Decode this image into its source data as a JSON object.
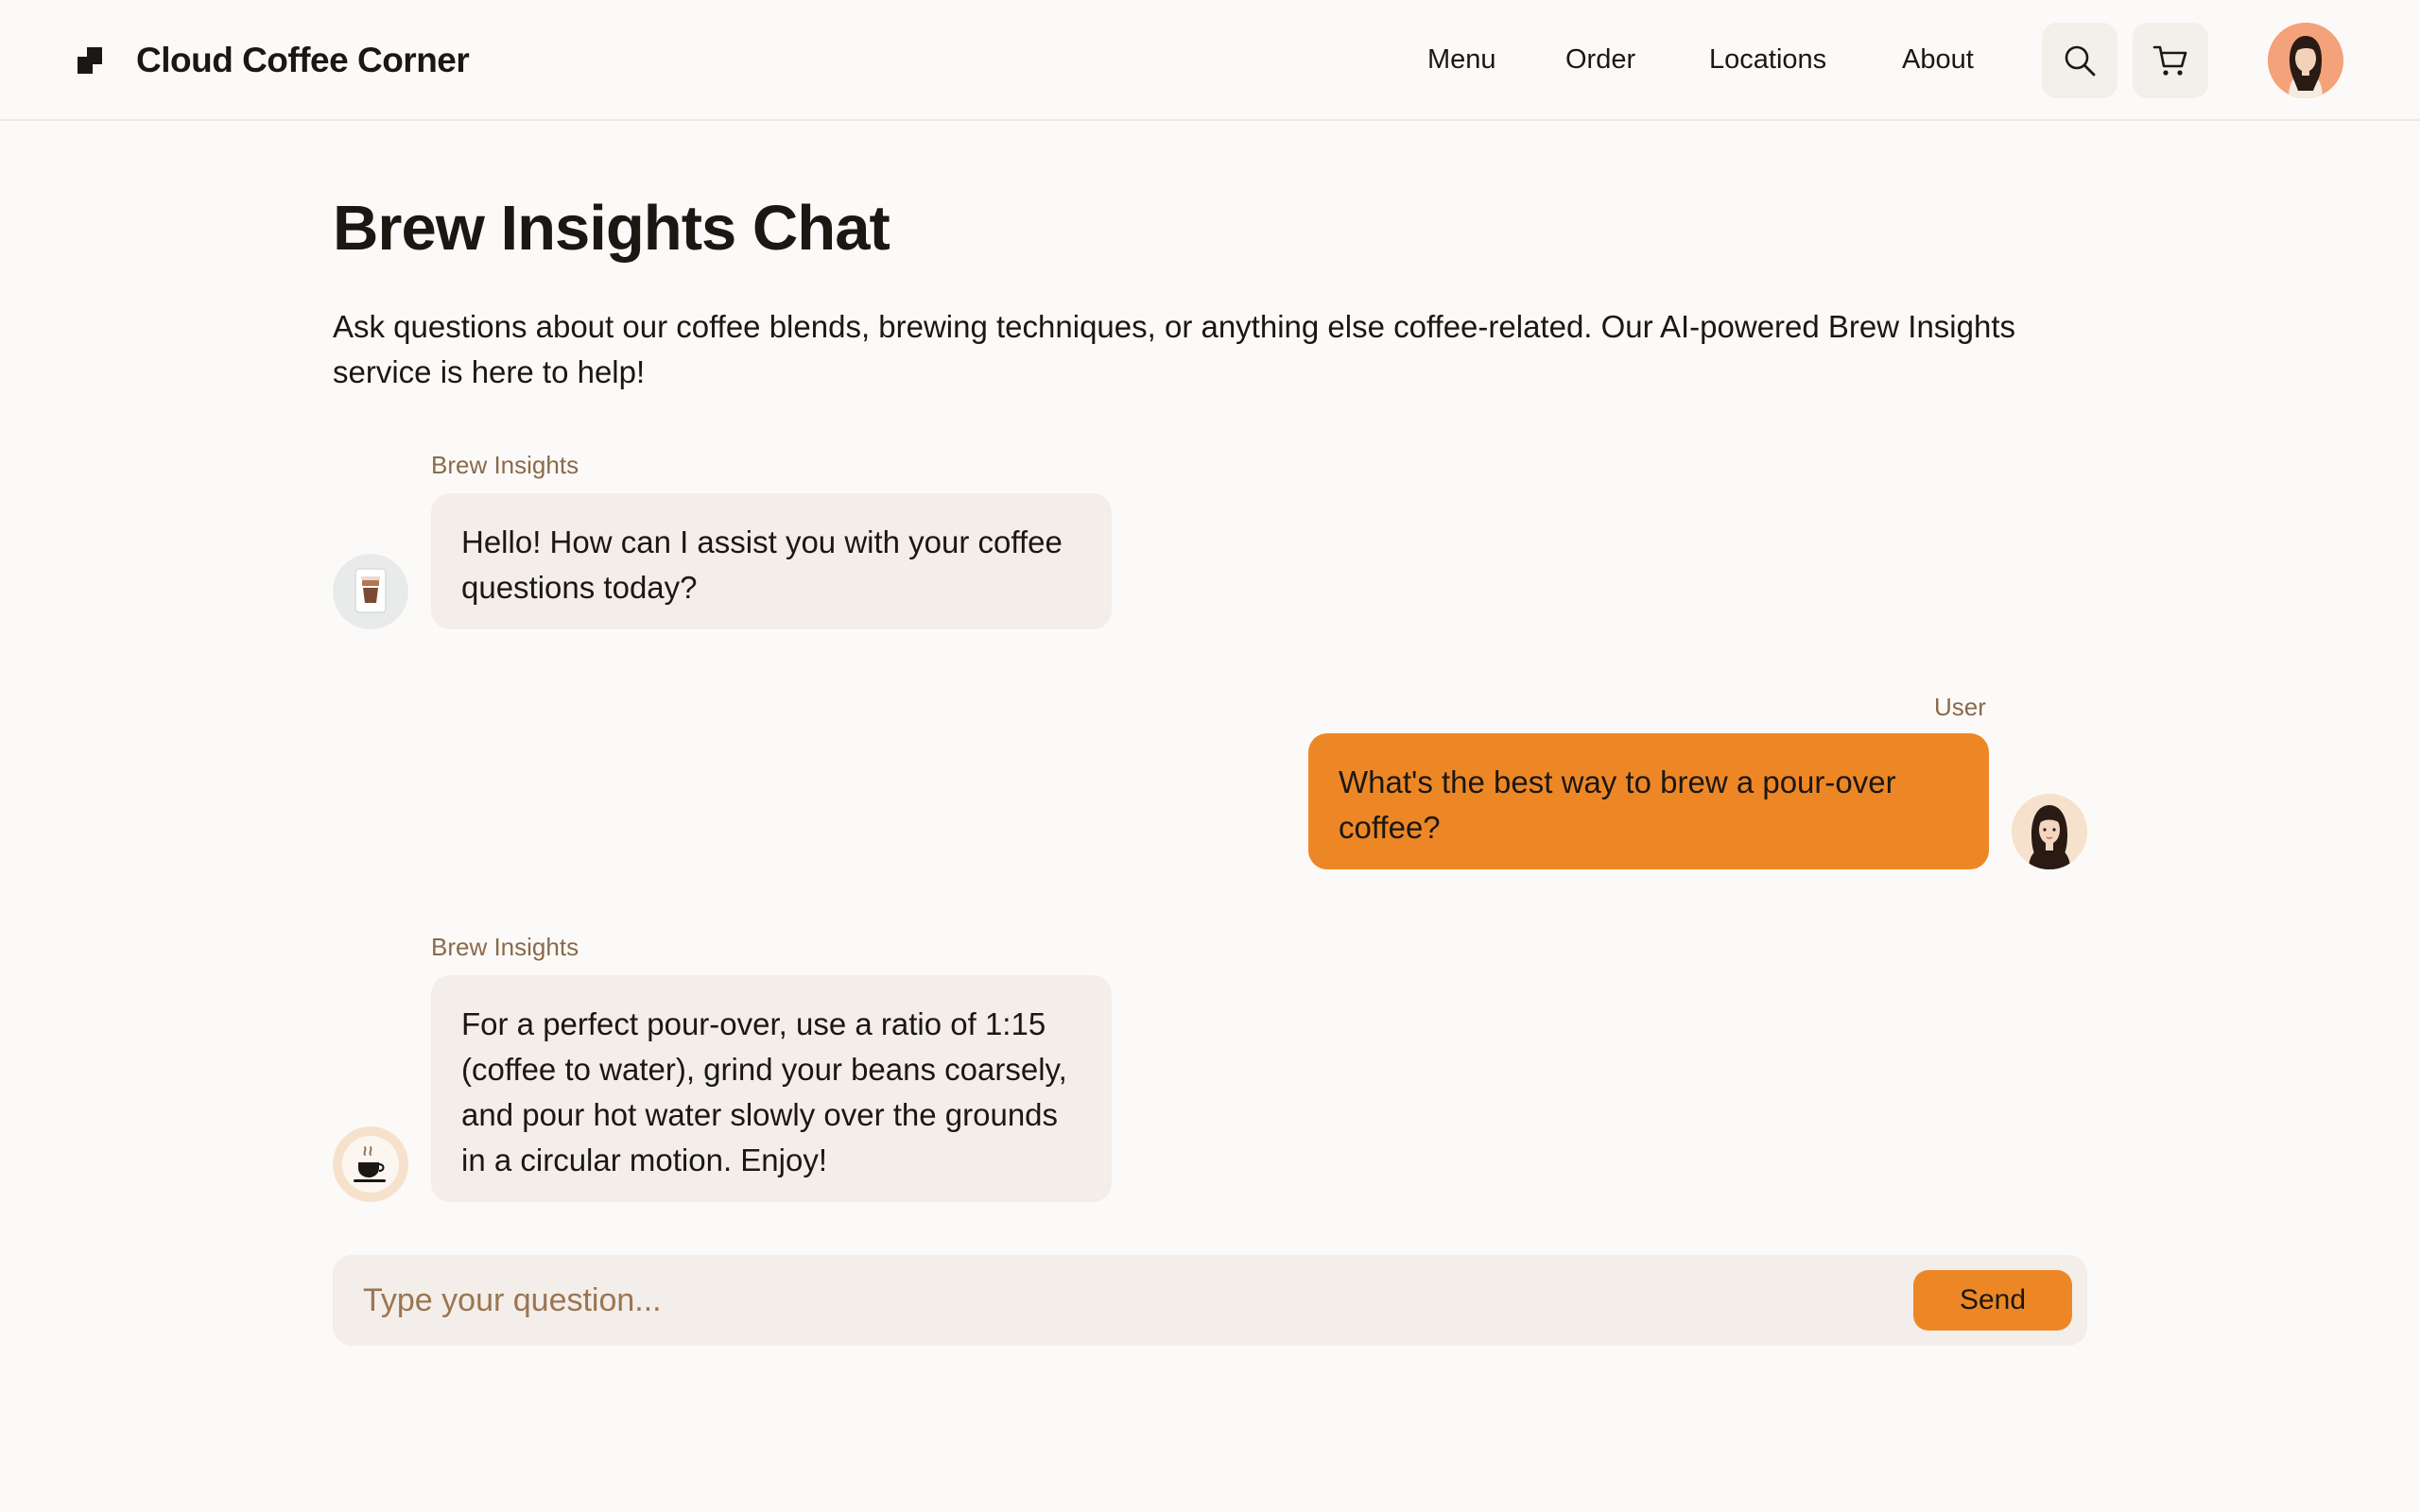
{
  "header": {
    "brand": "Cloud Coffee Corner",
    "nav": [
      "Menu",
      "Order",
      "Locations",
      "About"
    ],
    "search_icon": "search-icon",
    "cart_icon": "cart-icon"
  },
  "main": {
    "title": "Brew Insights Chat",
    "description": "Ask questions about our coffee blends, brewing techniques, or anything else coffee-related. Our AI-powered Brew Insights service is here to help!"
  },
  "messages": [
    {
      "sender": "Brew Insights",
      "text": "Hello! How can I assist you with your coffee questions today?"
    },
    {
      "sender": "User",
      "text": "What's the best way to brew a pour-over coffee?"
    },
    {
      "sender": "Brew Insights",
      "text": "For a perfect pour-over, use a ratio of 1:15 (coffee to water), grind your beans coarsely, and pour hot water slowly over the grounds in a circular motion. Enjoy!"
    }
  ],
  "composer": {
    "placeholder": "Type your question...",
    "value": "",
    "send_label": "Send"
  },
  "colors": {
    "accent": "#ed8726",
    "bubble": "#f3eee9",
    "background": "#fcfaf8",
    "label": "#8a6a4a"
  }
}
